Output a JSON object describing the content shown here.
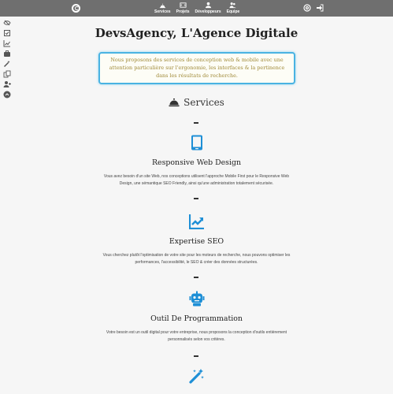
{
  "nav": {
    "items": [
      {
        "label": "Services",
        "icon": "bell-icon"
      },
      {
        "label": "Projets",
        "icon": "code-icon"
      },
      {
        "label": "Développeurs",
        "icon": "user-icon"
      },
      {
        "label": "Equipe",
        "icon": "users-icon"
      }
    ]
  },
  "header": {
    "title": "DevsAgency, L'Agence Digitale",
    "intro": "Nous proposons des services de conception web & mobile avec une attention particulière sur l'ergonomie, les interfaces & la pertinence dans les résultats de recherche."
  },
  "services": {
    "heading": "Services",
    "items": [
      {
        "title": "Responsive Web Design",
        "description": "Vous avez besoin d'un site Web, nos conceptions utilisent l'approche Mobile First pour le Responsive Web Design, une sémantique SEO Friendly, ainsi qu'une administration totalement sécurisée.",
        "icon": "tablet-icon"
      },
      {
        "title": "Expertise SEO",
        "description": "Vous cherchez plutôt l'optimisation de votre site pour les moteurs de recherche, nous pouvons optimiser les performances, l'accessibilité, le SEO & créer des données structurées.",
        "icon": "trending-up-icon"
      },
      {
        "title": "Outil De Programmation",
        "description": "Votre besoin est un outil digital pour votre entreprise, nous proposons la conception d'outils entièrement personnalisés selon vos critères.",
        "icon": "robot-icon"
      }
    ]
  },
  "colors": {
    "topbar": "#6f6f6f",
    "accent": "#1e8fd6",
    "intro_border": "#4ab3e2",
    "intro_text": "#a08a38"
  }
}
